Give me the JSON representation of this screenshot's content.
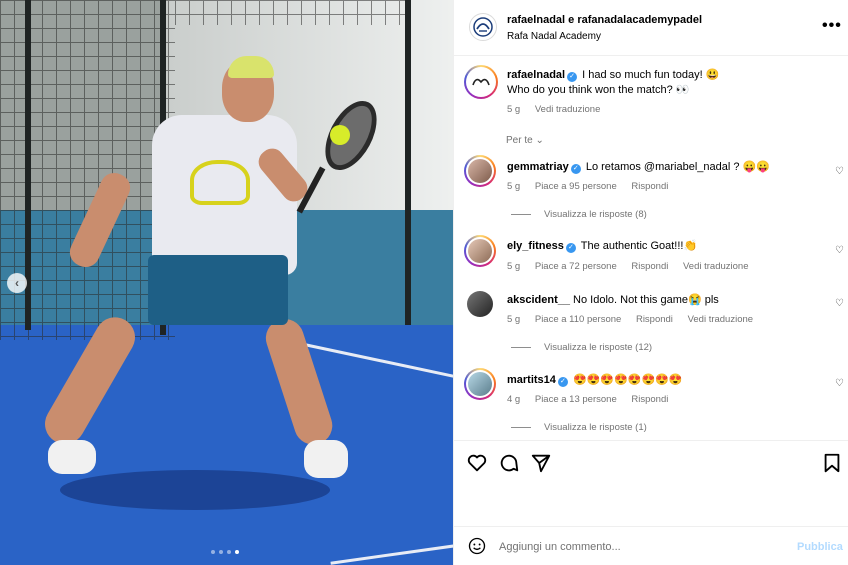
{
  "post_image": {
    "alt_subject": "",
    "carousel_dots": 4,
    "active_dot": 3
  },
  "header": {
    "names": "rafaelnadal e rafanadalacademypadel",
    "subtitle": "Rafa Nadal Academy",
    "more_icon": "more-horizontal-icon"
  },
  "caption": {
    "username": "rafaelnadal",
    "line1": "I had so much fun today! 😃",
    "line2": "Who do you think won the match? 👀",
    "age": "5 g",
    "translate": "Vedi traduzione"
  },
  "filter_label": "Per te",
  "comments": [
    {
      "username": "gemmatriay",
      "text": "Lo retamos @mariabel_nadal ? 😛😛",
      "age": "5 g",
      "likes": "Piace a 95 persone",
      "reply": "Rispondi",
      "translate": "",
      "view_replies": "Visualizza le risposte (8)"
    },
    {
      "username": "ely_fitness",
      "text": "The authentic Goat!!!👏",
      "age": "5 g",
      "likes": "Piace a 72 persone",
      "reply": "Rispondi",
      "translate": "Vedi traduzione",
      "view_replies": ""
    },
    {
      "username": "akscident__",
      "text": "No Idolo. Not this game😭 pls",
      "age": "5 g",
      "likes": "Piace a 110 persone",
      "reply": "Rispondi",
      "translate": "Vedi traduzione",
      "view_replies": "Visualizza le risposte (12)"
    },
    {
      "username": "martits14",
      "text": "😍😍😍😍😍😍😍😍",
      "age": "4 g",
      "likes": "Piace a 13 persone",
      "reply": "Rispondi",
      "translate": "",
      "view_replies": "Visualizza le risposte (1)"
    }
  ],
  "add_comment": {
    "placeholder": "Aggiungi un commento...",
    "publish": "Pubblica"
  },
  "colors": {
    "verified": "#3897f0",
    "muted": "#737373",
    "publish_disabled": "#b3dbff"
  }
}
